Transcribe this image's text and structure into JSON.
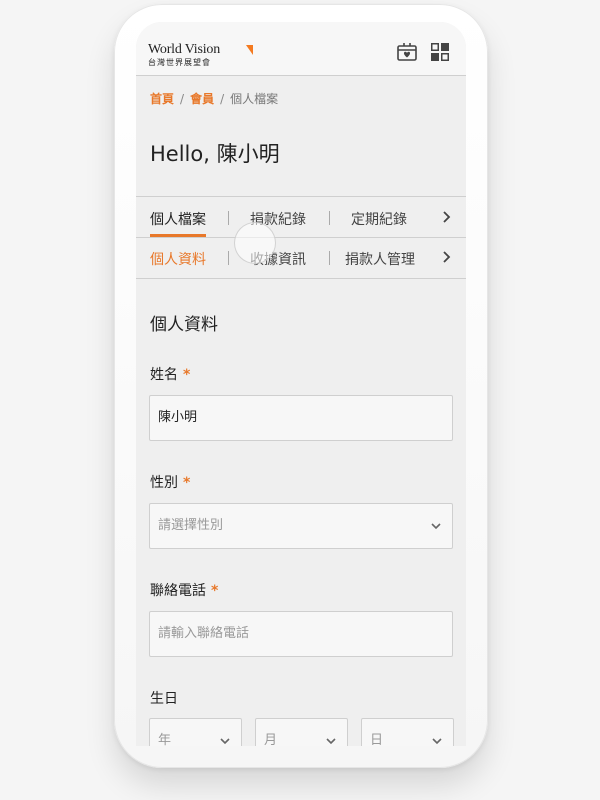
{
  "header": {
    "logo_en": "World Vision",
    "logo_zh": "台灣世界展望會",
    "gift_icon": "gift-heart-icon",
    "menu_icon": "menu-grid-icon"
  },
  "breadcrumb": {
    "items": [
      "首頁",
      "會員",
      "個人檔案"
    ],
    "separator": "/"
  },
  "greeting": "Hello, 陳小明",
  "tabs_primary": {
    "items": [
      "個人檔案",
      "捐款紀錄",
      "定期紀錄"
    ],
    "active": "個人檔案"
  },
  "tabs_secondary": {
    "items": [
      "個人資料",
      "收據資訊",
      "捐款人管理"
    ],
    "active": "個人資料"
  },
  "form": {
    "title": "個人資料",
    "required_mark": "*",
    "name": {
      "label": "姓名",
      "value": "陳小明"
    },
    "gender": {
      "label": "性別",
      "placeholder": "請選擇性別"
    },
    "phone": {
      "label": "聯絡電話",
      "placeholder": "請輸入聯絡電話"
    },
    "birthday": {
      "label": "生日",
      "year": "年",
      "month": "月",
      "day": "日"
    }
  },
  "colors": {
    "accent": "#e8782a",
    "logo_flag": "#f47a20",
    "screen_bg": "#efefef"
  }
}
